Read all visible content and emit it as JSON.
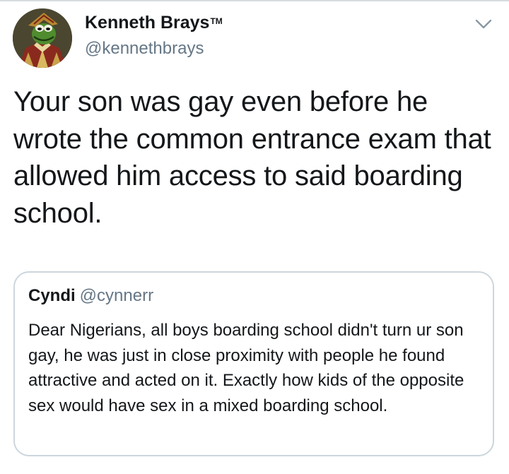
{
  "tweet": {
    "author": {
      "display_name": "Kenneth Brays",
      "trademark": "TM",
      "handle": "@kennethbrays"
    },
    "text": "Your son was gay even before he wrote the common entrance exam that allowed him access to said boarding school.",
    "menu_icon": "chevron-down-icon"
  },
  "quoted_tweet": {
    "author": {
      "display_name": "Cyndi",
      "handle": "@cynnerr"
    },
    "text": "Dear Nigerians, all boys boarding school didn't turn ur son gay, he was just in close proximity with people he found attractive and acted on it. Exactly how kids of the opposite sex would have sex in a mixed boarding school."
  },
  "colors": {
    "text_primary": "#14171a",
    "text_secondary": "#657786",
    "border": "#ccd6dd"
  }
}
